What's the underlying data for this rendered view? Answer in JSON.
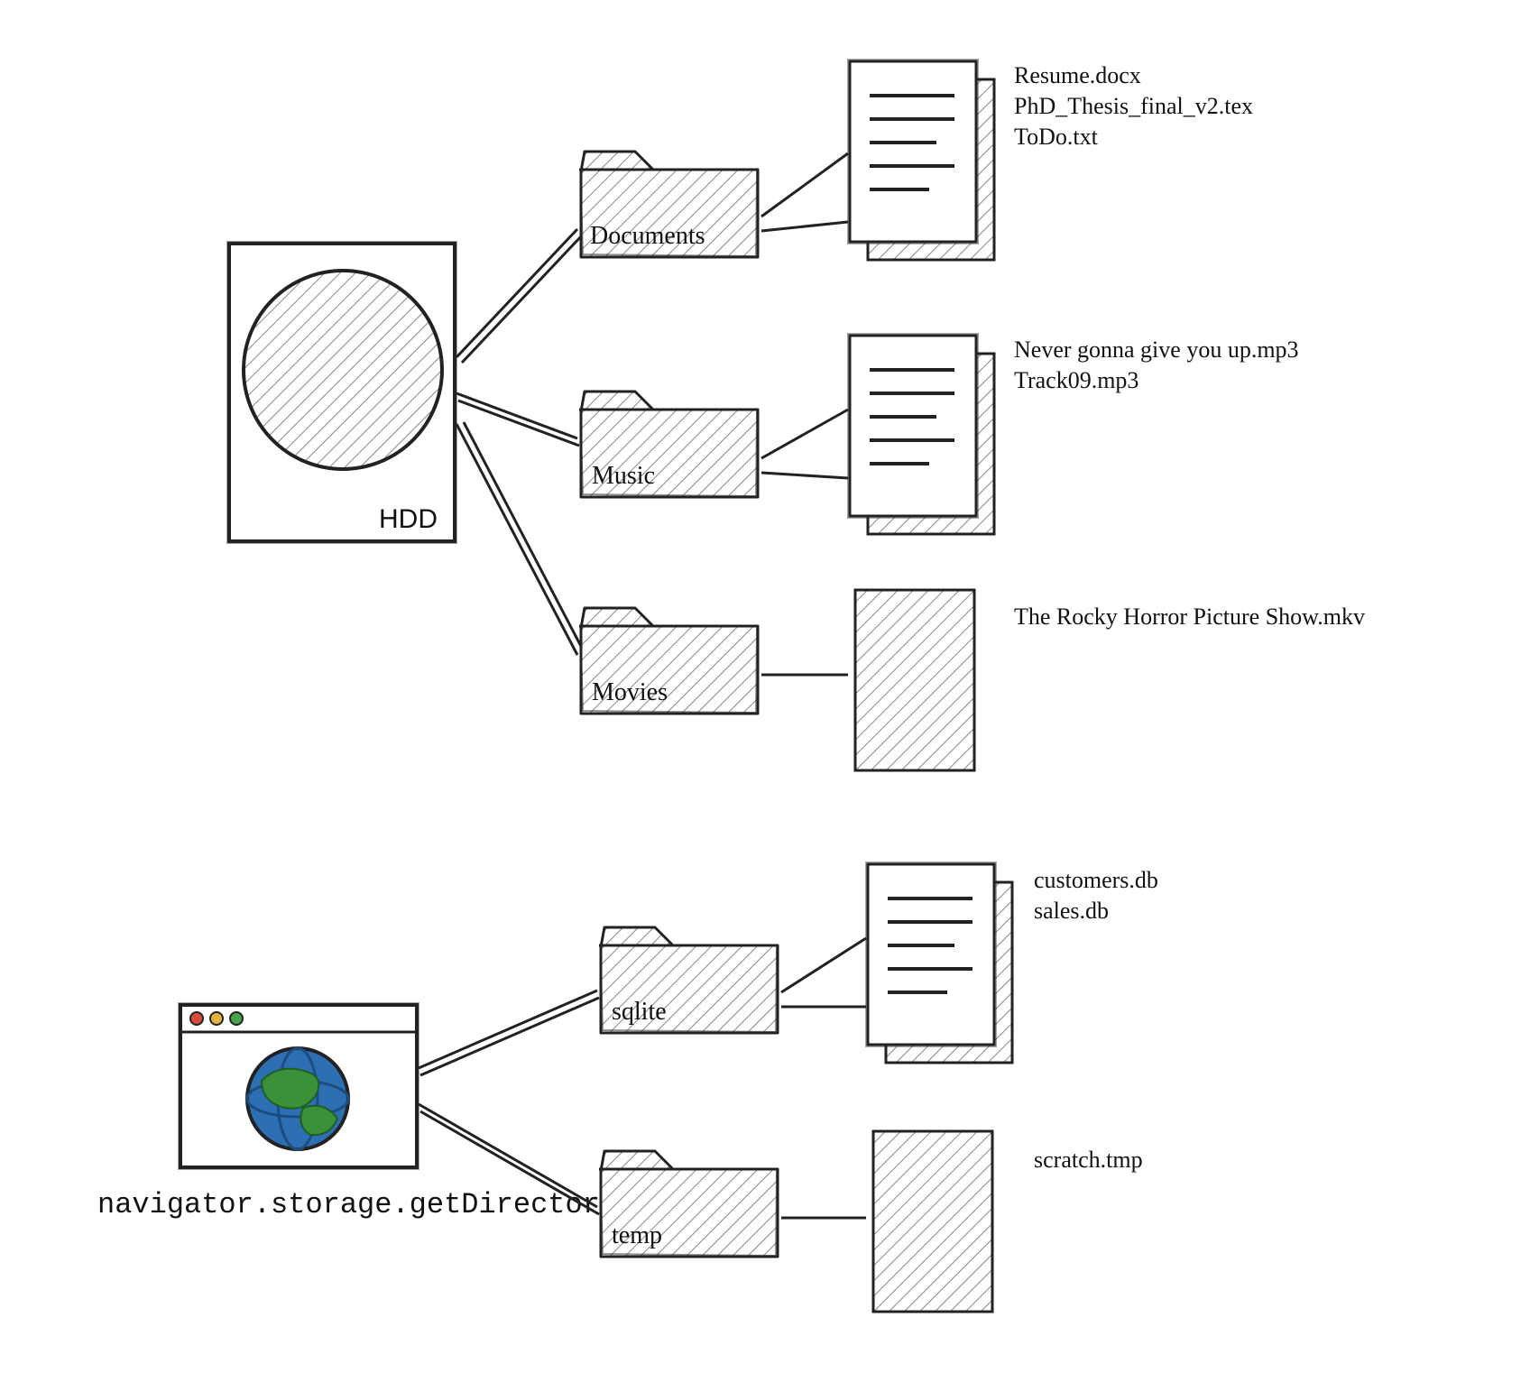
{
  "hdd": {
    "label": "HDD",
    "folders": [
      {
        "name": "Documents",
        "files": [
          "Resume.docx",
          "PhD_Thesis_final_v2.tex",
          "ToDo.txt"
        ]
      },
      {
        "name": "Music",
        "files": [
          "Never gonna give you up.mp3",
          "Track09.mp3"
        ]
      },
      {
        "name": "Movies",
        "files": [
          "The Rocky Horror Picture Show.mkv"
        ]
      }
    ]
  },
  "browser": {
    "api_label": "navigator.storage.getDirectory()",
    "folders": [
      {
        "name": "sqlite",
        "files": [
          "customers.db",
          "sales.db"
        ]
      },
      {
        "name": "temp",
        "files": [
          "scratch.tmp"
        ]
      }
    ]
  }
}
